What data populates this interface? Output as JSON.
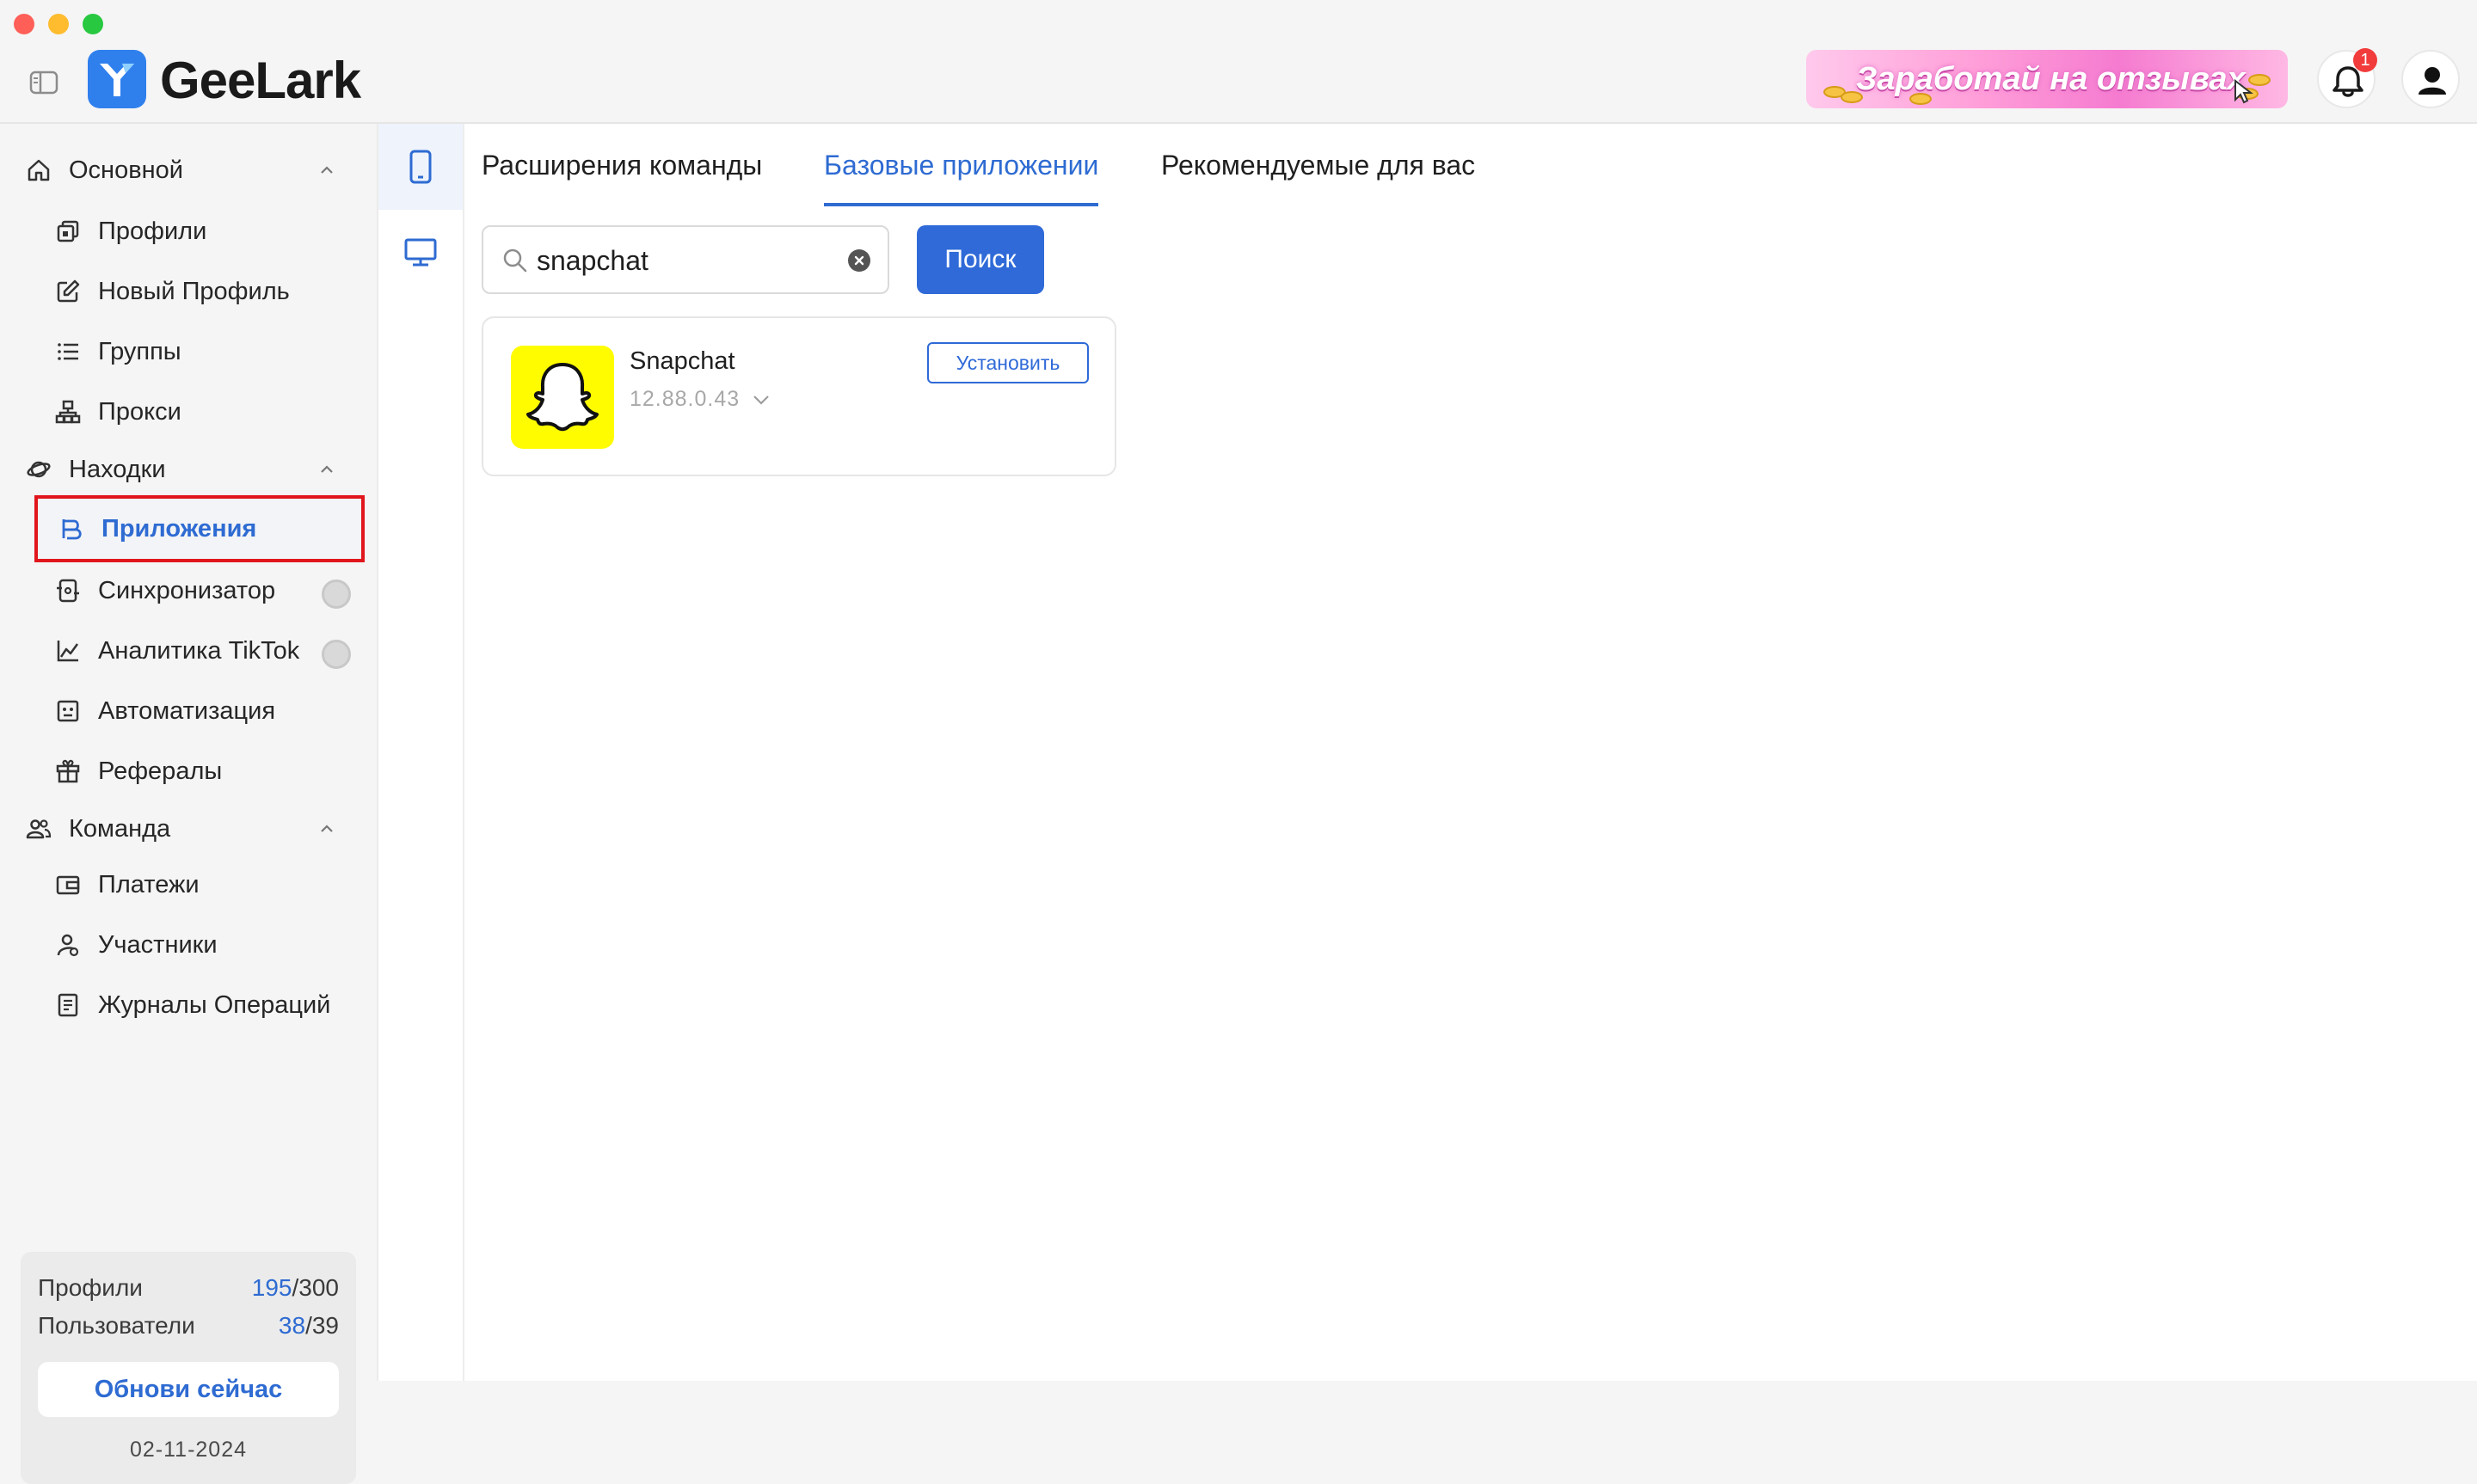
{
  "header": {
    "logo_text": "GeeLark",
    "promo_text": "Заработай на отзывах",
    "notification_count": "1"
  },
  "sidebar": {
    "sections": [
      {
        "label": "Основной",
        "items": [
          "Профили",
          "Новый Профиль",
          "Группы",
          "Прокси"
        ]
      },
      {
        "label": "Находки",
        "items": [
          "Приложения",
          "Синхронизатор",
          "Аналитика TikTok",
          "Автоматизация",
          "Рефералы"
        ]
      },
      {
        "label": "Команда",
        "items": [
          "Платежи",
          "Участники",
          "Журналы Операций"
        ]
      }
    ],
    "active_item": "Приложения"
  },
  "quota": {
    "profiles_label": "Профили",
    "profiles_used": "195",
    "profiles_total": "/300",
    "users_label": "Пользователи",
    "users_used": "38",
    "users_total": "/39",
    "upgrade_label": "Обнови сейчас",
    "date": "02-11-2024"
  },
  "main": {
    "tabs": [
      "Расширения команды",
      "Базовые приложении",
      "Рекомендуемые для вас"
    ],
    "active_tab": "Базовые приложении",
    "search": {
      "value": "snapchat",
      "button_label": "Поиск"
    },
    "app": {
      "name": "Snapchat",
      "version": "12.88.0.43",
      "install_label": "Установить"
    }
  },
  "colors": {
    "accent": "#2f6ad8",
    "active_outline": "#e0161c",
    "snapchat_yellow": "#fffc00",
    "badge": "#f23c3c"
  }
}
